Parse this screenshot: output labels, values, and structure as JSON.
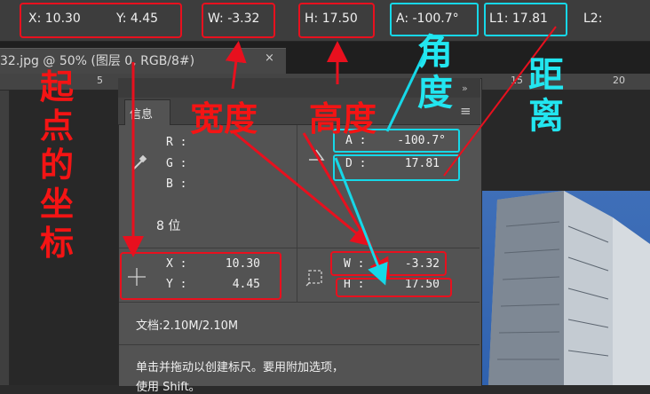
{
  "options_bar": {
    "x": "X: 10.30",
    "y": "Y: 4.45",
    "w": "W: -3.32",
    "h": "H: 17.50",
    "a": "A: -100.7°",
    "l1": "L1: 17.81",
    "l2": "L2:"
  },
  "document_tab": {
    "title": "32.jpg @ 50% (图层 0, RGB/8#)",
    "close_glyph": "×"
  },
  "ruler": {
    "labels": [
      "5",
      "15",
      "20"
    ]
  },
  "panel": {
    "tab_label": "信息",
    "rgb": {
      "r": "R :",
      "g": "G :",
      "b": "B :"
    },
    "bits": "8 位",
    "angle": {
      "a_label": "A :",
      "a_value": "-100.7°",
      "d_label": "D :",
      "d_value": "17.81"
    },
    "coords": {
      "x_label": "X :",
      "x_value": "10.30",
      "y_label": "Y :",
      "y_value": "4.45"
    },
    "size": {
      "w_label": "W :",
      "w_value": "-3.32",
      "h_label": "H :",
      "h_value": "17.50"
    },
    "doc": "文档:2.10M/2.10M",
    "hint_line1": "单击并拖动以创建标尺。要用附加选项，",
    "hint_line2": "使用 Shift。"
  },
  "annotations": {
    "origin": [
      "起",
      "点",
      "的",
      "坐",
      "标"
    ],
    "width": "宽度",
    "height": "高度",
    "angle": [
      "角",
      "度"
    ],
    "distance": [
      "距",
      "离"
    ]
  },
  "colors": {
    "red": "#e8101e",
    "cyan": "#16d8e8",
    "panel": "#535353"
  }
}
